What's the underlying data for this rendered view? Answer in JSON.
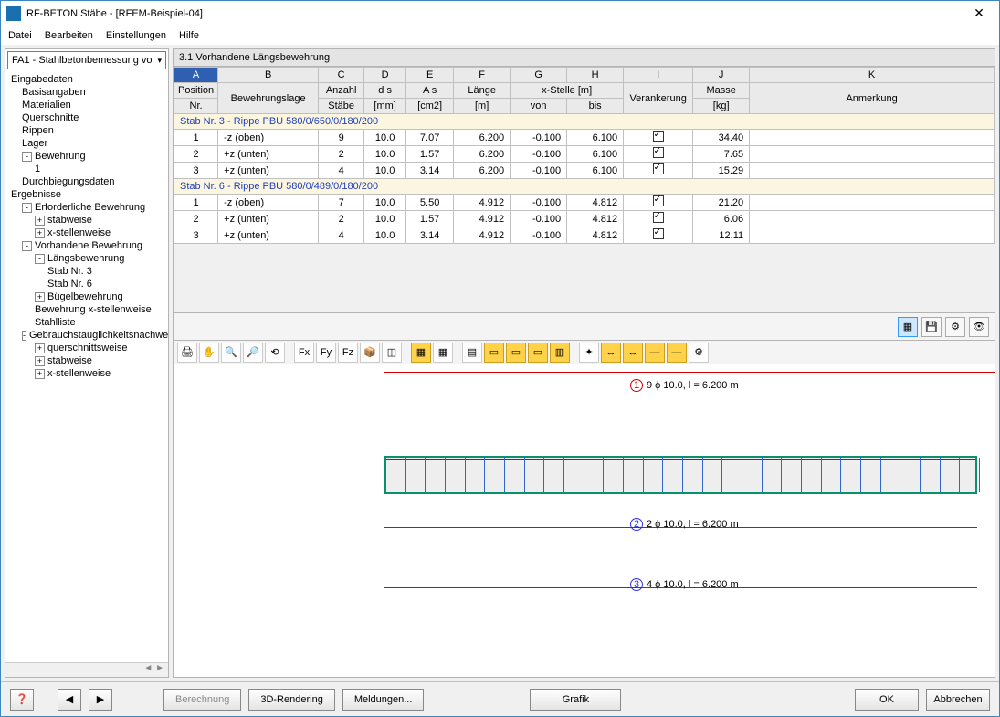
{
  "window": {
    "title": "RF-BETON Stäbe - [RFEM-Beispiel-04]"
  },
  "menu": {
    "datei": "Datei",
    "bearbeiten": "Bearbeiten",
    "einstellungen": "Einstellungen",
    "hilfe": "Hilfe"
  },
  "combo": {
    "label": "FA1 - Stahlbetonbemessung vo"
  },
  "tree": {
    "eingabedaten": "Eingabedaten",
    "basisangaben": "Basisangaben",
    "materialien": "Materialien",
    "querschnitte": "Querschnitte",
    "rippen": "Rippen",
    "lager": "Lager",
    "bewehrung": "Bewehrung",
    "bewehrung1": "1",
    "durchbiegung": "Durchbiegungsdaten",
    "ergebnisse": "Ergebnisse",
    "erforderlich": "Erforderliche Bewehrung",
    "stabweise": "stabweise",
    "xstellen": "x-stellenweise",
    "vorhanden": "Vorhandene Bewehrung",
    "laengs": "Längsbewehrung",
    "stab3": "Stab Nr. 3",
    "stab6": "Stab Nr. 6",
    "buegel": "Bügelbewehrung",
    "bewx": "Bewehrung x-stellenweise",
    "stahlliste": "Stahlliste",
    "gebrauch": "Gebrauchstauglichkeitsnachwei",
    "querschnittsweise": "querschnittsweise",
    "stabweise2": "stabweise",
    "xstellen2": "x-stellenweise"
  },
  "panel": {
    "title": "3.1 Vorhandene Längsbewehrung"
  },
  "cols": {
    "A": "A",
    "B": "B",
    "C": "C",
    "D": "D",
    "E": "E",
    "F": "F",
    "G": "G",
    "H": "H",
    "I": "I",
    "J": "J",
    "K": "K",
    "position": "Position",
    "nr": "Nr.",
    "lage": "Bewehrungslage",
    "anzahl": "Anzahl",
    "staebe": "Stäbe",
    "ds": "d s",
    "mm": "[mm]",
    "as": "A s",
    "cm2": "[cm2]",
    "laenge": "Länge",
    "m": "[m]",
    "xstelle": "x-Stelle [m]",
    "von": "von",
    "bis": "bis",
    "verankerung": "Verankerung",
    "masse": "Masse",
    "kg": "[kg]",
    "anmerkung": "Anmerkung"
  },
  "group1": "Stab Nr. 3  -  Rippe PBU 580/0/650/0/180/200",
  "group2": "Stab Nr. 6  -  Rippe PBU 580/0/489/0/180/200",
  "rows1": [
    {
      "pos": "1",
      "lage": "-z (oben)",
      "n": "9",
      "ds": "10.0",
      "as": "7.07",
      "l": "6.200",
      "von": "-0.100",
      "bis": "6.100",
      "m": "34.40"
    },
    {
      "pos": "2",
      "lage": "+z (unten)",
      "n": "2",
      "ds": "10.0",
      "as": "1.57",
      "l": "6.200",
      "von": "-0.100",
      "bis": "6.100",
      "m": "7.65"
    },
    {
      "pos": "3",
      "lage": "+z (unten)",
      "n": "4",
      "ds": "10.0",
      "as": "3.14",
      "l": "6.200",
      "von": "-0.100",
      "bis": "6.100",
      "m": "15.29"
    }
  ],
  "rows2": [
    {
      "pos": "1",
      "lage": "-z (oben)",
      "n": "7",
      "ds": "10.0",
      "as": "5.50",
      "l": "4.912",
      "von": "-0.100",
      "bis": "4.812",
      "m": "21.20"
    },
    {
      "pos": "2",
      "lage": "+z (unten)",
      "n": "2",
      "ds": "10.0",
      "as": "1.57",
      "l": "4.912",
      "von": "-0.100",
      "bis": "4.812",
      "m": "6.06"
    },
    {
      "pos": "3",
      "lage": "+z (unten)",
      "n": "4",
      "ds": "10.0",
      "as": "3.14",
      "l": "4.912",
      "von": "-0.100",
      "bis": "4.812",
      "m": "12.11"
    }
  ],
  "drawing": {
    "label1": "9 ϕ 10.0, l = 6.200 m",
    "label2": "2 ϕ 10.0, l = 6.200 m",
    "label3": "4 ϕ 10.0, l = 6.200 m"
  },
  "buttons": {
    "berechnung": "Berechnung",
    "rendering": "3D-Rendering",
    "meldungen": "Meldungen...",
    "grafik": "Grafik",
    "ok": "OK",
    "abbrechen": "Abbrechen"
  }
}
